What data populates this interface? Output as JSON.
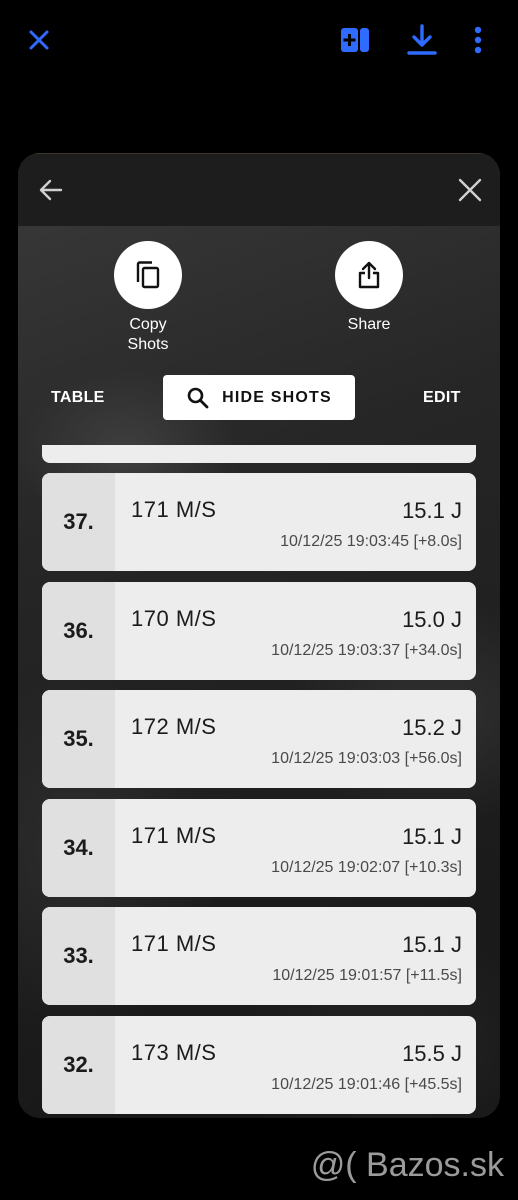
{
  "topbar": {
    "icons": [
      "close-icon",
      "layout-add-icon",
      "download-icon",
      "more-vert-icon"
    ],
    "accent": "#2f6bff"
  },
  "dialog": {
    "actions": [
      {
        "label": "Copy\nShots",
        "icon": "copy-icon"
      },
      {
        "label": "Share",
        "icon": "share-icon"
      }
    ],
    "tabs": {
      "table": "TABLE",
      "hide_shots": "HIDE SHOTS",
      "edit": "EDIT"
    },
    "shots": [
      {
        "index": "37.",
        "speed": "171 M/S",
        "energy": "15.1 J",
        "time": "10/12/25 19:03:45 [+8.0s]"
      },
      {
        "index": "36.",
        "speed": "170 M/S",
        "energy": "15.0 J",
        "time": "10/12/25 19:03:37 [+34.0s]"
      },
      {
        "index": "35.",
        "speed": "172 M/S",
        "energy": "15.2 J",
        "time": "10/12/25 19:03:03 [+56.0s]"
      },
      {
        "index": "34.",
        "speed": "171 M/S",
        "energy": "15.1 J",
        "time": "10/12/25 19:02:07 [+10.3s]"
      },
      {
        "index": "33.",
        "speed": "171 M/S",
        "energy": "15.1 J",
        "time": "10/12/25 19:01:57 [+11.5s]"
      },
      {
        "index": "32.",
        "speed": "173 M/S",
        "energy": "15.5 J",
        "time": "10/12/25 19:01:46 [+45.5s]"
      }
    ]
  },
  "watermark": "@( Bazos.sk"
}
